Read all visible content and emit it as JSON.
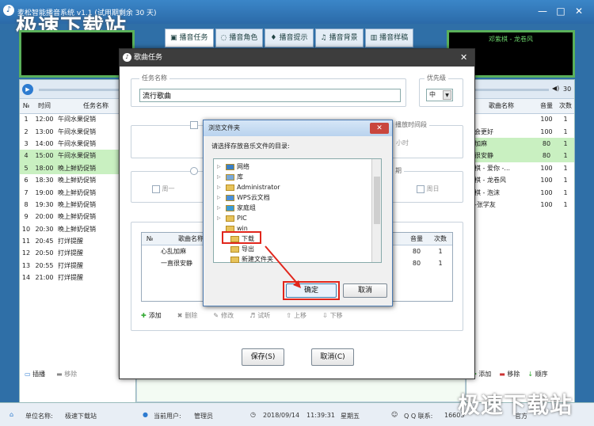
{
  "app": {
    "title": "麦松智能播音系统 v1.1 (试用期剩余 30 天)",
    "watermark": "极速下载站",
    "win_min": "—",
    "win_max": "□",
    "win_close": "✕"
  },
  "tabs": [
    {
      "label": "播音任务",
      "icon": "speaker-icon"
    },
    {
      "label": "播音角色",
      "icon": "chat-icon"
    },
    {
      "label": "播音提示",
      "icon": "bell-icon"
    },
    {
      "label": "播音背景",
      "icon": "music-icon"
    },
    {
      "label": "播音样稿",
      "icon": "book-icon"
    }
  ],
  "right_screen": {
    "text": "邓紫棋 - 龙卷风"
  },
  "left_table": {
    "headers": [
      "№",
      "时间",
      "任务名称"
    ],
    "rows": [
      [
        "1",
        "12:00",
        "午间水果促销"
      ],
      [
        "2",
        "13:00",
        "午间水果促销"
      ],
      [
        "3",
        "14:00",
        "午间水果促销"
      ],
      [
        "4",
        "15:00",
        "午间水果促销"
      ],
      [
        "5",
        "18:00",
        "晚上鲜奶促销"
      ],
      [
        "6",
        "18:30",
        "晚上鲜奶促销"
      ],
      [
        "7",
        "19:00",
        "晚上鲜奶促销"
      ],
      [
        "8",
        "19:30",
        "晚上鲜奶促销"
      ],
      [
        "9",
        "20:00",
        "晚上鲜奶促销"
      ],
      [
        "10",
        "20:30",
        "晚上鲜奶促销"
      ],
      [
        "11",
        "20:45",
        "打烊提醒"
      ],
      [
        "12",
        "20:50",
        "打烊提醒"
      ],
      [
        "13",
        "20:55",
        "打烊提醒"
      ],
      [
        "14",
        "21:00",
        "打烊提醒"
      ]
    ],
    "highlight": [
      3,
      4
    ]
  },
  "left_buttons": {
    "insert": "插播",
    "remove": "移除"
  },
  "right_table": {
    "headers": [
      "歌曲名称",
      "音量",
      "次数"
    ],
    "rows": [
      [
        "敢",
        "100",
        "1"
      ],
      [
        "不会更好",
        "100",
        "1"
      ],
      [
        "乱加麻",
        "80",
        "1"
      ],
      [
        "直很安静",
        "80",
        "1"
      ],
      [
        "紫棋 - 爱你 -...",
        "100",
        "1"
      ],
      [
        "紫棋 - 龙卷风",
        "100",
        "1"
      ],
      [
        "紫棋 - 泡沫",
        "100",
        "1"
      ],
      [
        "刚-张学友",
        "100",
        "1"
      ]
    ],
    "highlight": [
      2,
      3
    ],
    "volume": "30"
  },
  "right_buttons": {
    "add": "添加",
    "remove": "移除",
    "order": "顺序"
  },
  "status": {
    "unit_label": "单位名称:",
    "unit_value": "极速下载站",
    "user_label": "当前用户:",
    "user_value": "管理员",
    "date": "2018/09/14",
    "time": "11:39:31",
    "weekday": "星期五",
    "qq_label": "Q Q 联系:",
    "qq_value": "16603",
    "official": "官方"
  },
  "dialog": {
    "title": "歌曲任务",
    "name_legend": "任务名称",
    "name_value": "流行歌曲",
    "priority_legend": "优先级",
    "priority_value": "中",
    "slot_label": "播放时间段",
    "hours_label": "小时",
    "period_label": "期",
    "week": {
      "mon": "周一",
      "sun": "周日"
    },
    "song_headers": [
      "№",
      "歌曲名称",
      "音量",
      "次数"
    ],
    "songs": [
      [
        "",
        "心乱加麻",
        "80",
        "1"
      ],
      [
        "",
        "一直很安静",
        "80",
        "1"
      ]
    ],
    "toolbar": {
      "add": "添加",
      "delete": "删除",
      "edit": "修改",
      "listen": "试听",
      "up": "上移",
      "down": "下移"
    },
    "save": "保存(S)",
    "cancel": "取消(C)"
  },
  "browse": {
    "title": "浏览文件夹",
    "prompt": "请选择存放音乐文件的目录:",
    "items": [
      {
        "label": "网络",
        "icon": "network-icon"
      },
      {
        "label": "库",
        "icon": "library-icon"
      },
      {
        "label": "Administrator",
        "icon": "user-folder-icon"
      },
      {
        "label": "WPS云文档",
        "icon": "cloud-icon"
      },
      {
        "label": "家庭组",
        "icon": "homegroup-icon"
      },
      {
        "label": "PIC",
        "icon": "folder-icon"
      },
      {
        "label": "win",
        "icon": "folder-icon"
      },
      {
        "label": "下载",
        "icon": "folder-icon"
      },
      {
        "label": "导出",
        "icon": "folder-icon"
      },
      {
        "label": "新建文件夹",
        "icon": "folder-icon"
      }
    ],
    "selected": "下载",
    "ok": "确定",
    "cancel": "取消"
  }
}
